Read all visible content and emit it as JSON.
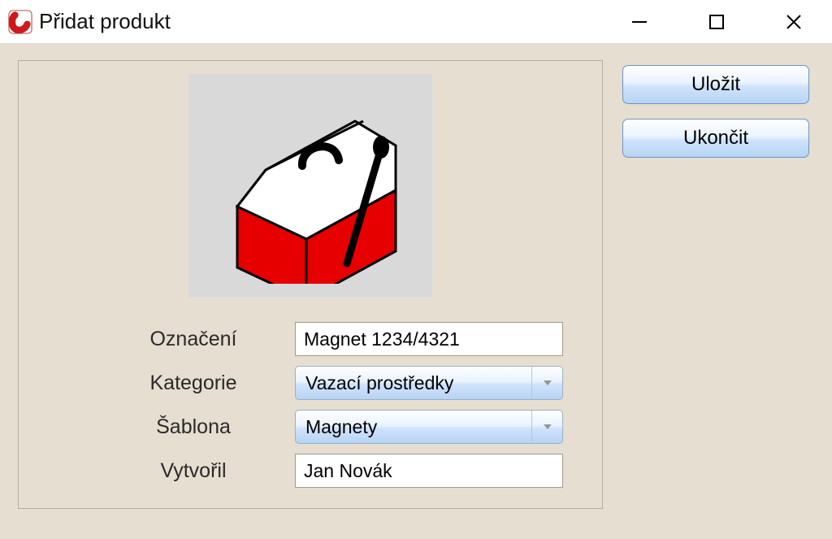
{
  "window": {
    "title": "Přidat produkt"
  },
  "actions": {
    "save_label": "Uložit",
    "close_label": "Ukončit"
  },
  "form": {
    "label_name": "Označení",
    "value_name": "Magnet 1234/4321",
    "label_category": "Kategorie",
    "value_category": "Vazací prostředky",
    "label_template": "Šablona",
    "value_template": "Magnety",
    "label_created_by": "Vytvořil",
    "value_created_by": "Jan Novák"
  }
}
